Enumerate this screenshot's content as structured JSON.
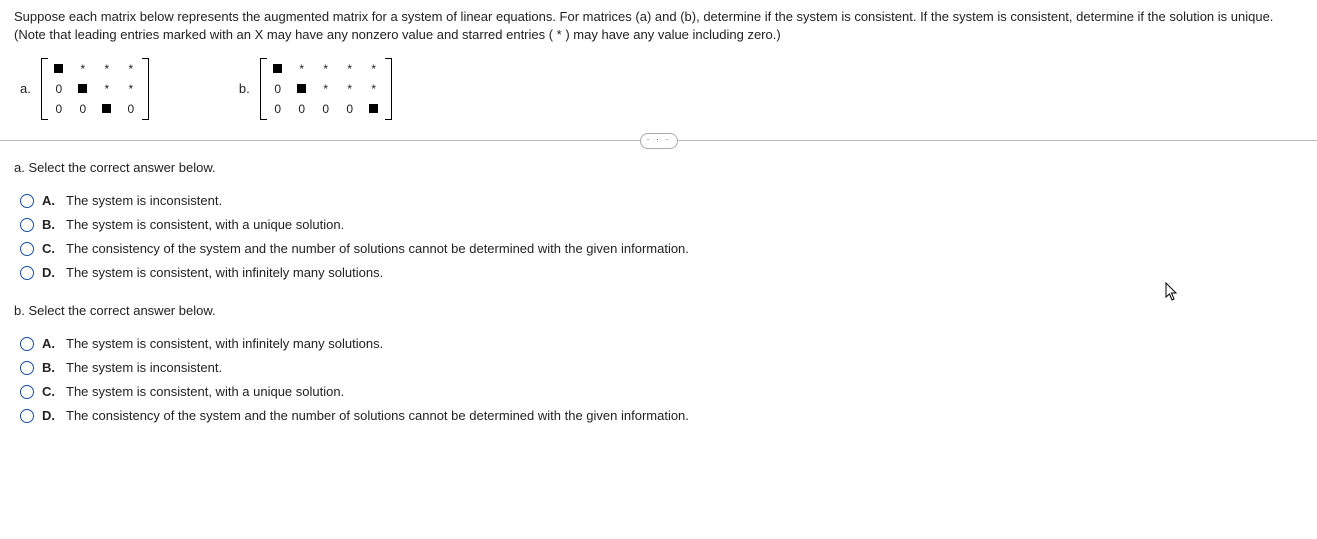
{
  "question": "Suppose each matrix below represents the augmented matrix for a system of linear equations. For matrices (a) and (b), determine if the system is consistent. If the system is consistent, determine if the solution is unique. (Note that leading entries marked with an X may have any nonzero value and starred entries ( * ) may have any value including zero.)",
  "matrices": {
    "a": {
      "label": "a.",
      "rows": [
        [
          "■",
          "*",
          "*",
          "*"
        ],
        [
          "0",
          "■",
          "*",
          "*"
        ],
        [
          "0",
          "0",
          "■",
          "0"
        ]
      ]
    },
    "b": {
      "label": "b.",
      "rows": [
        [
          "■",
          "*",
          "*",
          "*",
          "*"
        ],
        [
          "0",
          "■",
          "*",
          "*",
          "*"
        ],
        [
          "0",
          "0",
          "0",
          "0",
          "■"
        ]
      ]
    }
  },
  "expand_label": "· · ·",
  "part_a": {
    "prompt": "a. Select the correct answer below.",
    "options": [
      {
        "letter": "A.",
        "text": "The system is inconsistent."
      },
      {
        "letter": "B.",
        "text": "The system is consistent, with a unique solution."
      },
      {
        "letter": "C.",
        "text": "The consistency of the system and the number of solutions cannot be determined with the given information."
      },
      {
        "letter": "D.",
        "text": "The system is consistent, with infinitely many solutions."
      }
    ]
  },
  "part_b": {
    "prompt": "b. Select the correct answer below.",
    "options": [
      {
        "letter": "A.",
        "text": "The system is consistent, with infinitely many solutions."
      },
      {
        "letter": "B.",
        "text": "The system is inconsistent."
      },
      {
        "letter": "C.",
        "text": "The system is consistent, with a unique solution."
      },
      {
        "letter": "D.",
        "text": "The consistency of the system and the number of solutions cannot be determined with the given information."
      }
    ]
  }
}
